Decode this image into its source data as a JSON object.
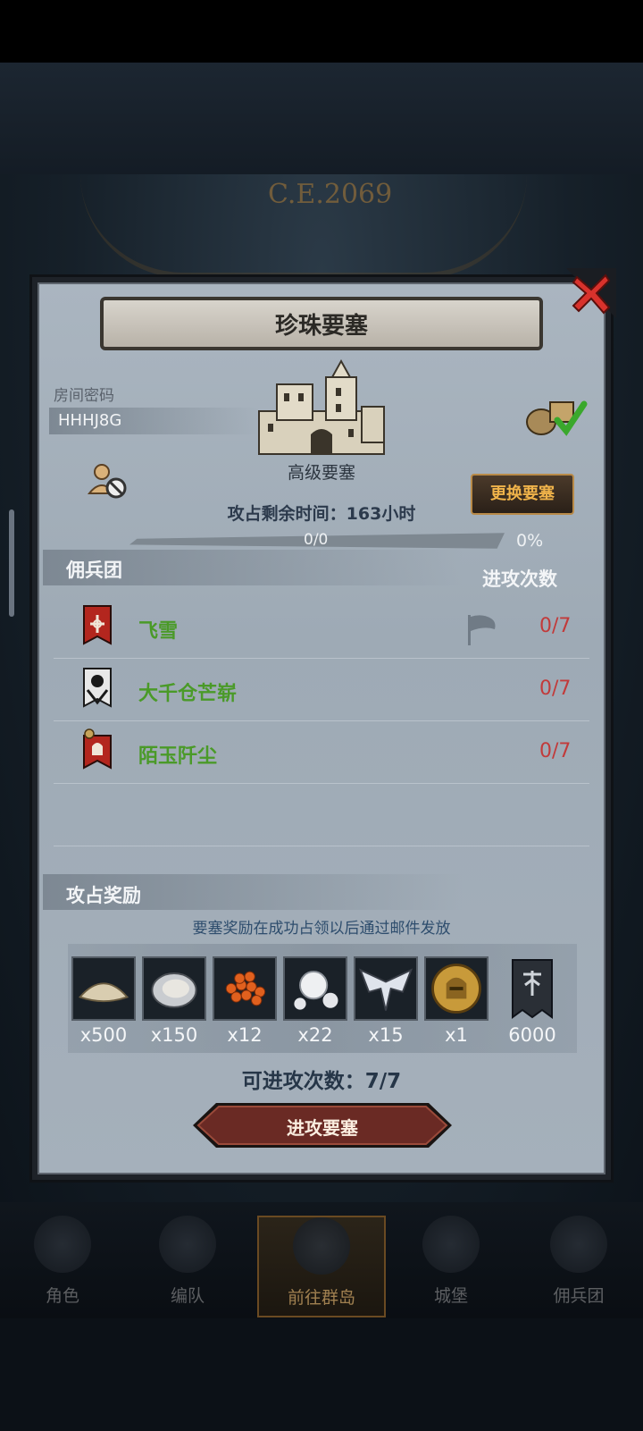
{
  "background": {
    "year_label": "C.E.2069"
  },
  "dialog": {
    "title": "珍珠要塞",
    "room_label": "房间密码",
    "room_code": "HHHJ8G",
    "fortress_type": "高级要塞",
    "change_button": "更换要塞",
    "time_remaining": "攻占剩余时间：163小时",
    "progress_text": "0/0",
    "progress_percent": "0%",
    "progress_value": 0
  },
  "mercenaries": {
    "header": "佣兵团",
    "attack_header": "进攻次数",
    "rows": [
      {
        "name": "飞雪",
        "count": "0/7",
        "banner_icon": "red-cross-banner-icon"
      },
      {
        "name": "大千仓芒崭",
        "count": "0/7",
        "banner_icon": "white-moon-banner-icon"
      },
      {
        "name": "陌玉阡尘",
        "count": "0/7",
        "banner_icon": "red-helm-banner-icon"
      }
    ]
  },
  "rewards": {
    "header": "攻占奖励",
    "note": "要塞奖励在成功占领以后通过邮件发放",
    "items": [
      {
        "icon": "flour-pile-icon",
        "qty": "x500"
      },
      {
        "icon": "oyster-icon",
        "qty": "x150"
      },
      {
        "icon": "caviar-icon",
        "qty": "x12"
      },
      {
        "icon": "pearls-icon",
        "qty": "x22"
      },
      {
        "icon": "silver-emblem-icon",
        "qty": "x15"
      },
      {
        "icon": "gold-helmet-coin-icon",
        "qty": "x1"
      },
      {
        "icon": "guild-banner-icon",
        "qty": "6000"
      }
    ]
  },
  "attacks_available": "可进攻次数：7/7",
  "attack_button": "进攻要塞",
  "nav": [
    {
      "label": "角色",
      "icon": "knight-icon"
    },
    {
      "label": "编队",
      "icon": "formation-icon"
    },
    {
      "label": "前往群岛",
      "icon": "islands-compass-icon"
    },
    {
      "label": "城堡",
      "icon": "castle-icon"
    },
    {
      "label": "佣兵团",
      "icon": "mercenary-fortress-icon"
    }
  ],
  "colors": {
    "merc_name": "#4a9a28",
    "merc_count": "#c23a3a",
    "accent_gold": "#f0b34a"
  }
}
